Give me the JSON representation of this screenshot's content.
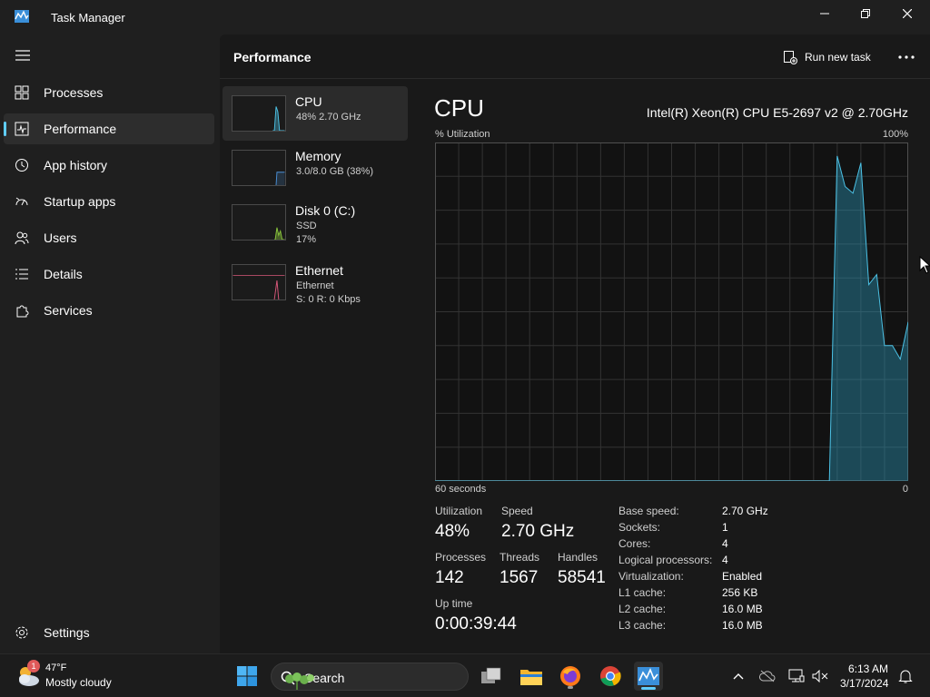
{
  "window": {
    "title": "Task Manager"
  },
  "sidebar": {
    "items": [
      {
        "label": "Processes",
        "icon": "grid-icon",
        "active": false
      },
      {
        "label": "Performance",
        "icon": "pulse-icon",
        "active": true
      },
      {
        "label": "App history",
        "icon": "history-icon",
        "active": false
      },
      {
        "label": "Startup apps",
        "icon": "gauge-icon",
        "active": false
      },
      {
        "label": "Users",
        "icon": "users-icon",
        "active": false
      },
      {
        "label": "Details",
        "icon": "list-icon",
        "active": false
      },
      {
        "label": "Services",
        "icon": "puzzle-icon",
        "active": false
      }
    ],
    "settings_label": "Settings"
  },
  "header": {
    "title": "Performance",
    "run_task_label": "Run new task"
  },
  "perf_list": [
    {
      "title": "CPU",
      "lines": [
        "48% 2.70 GHz"
      ],
      "color": "#4cc2e6",
      "active": true
    },
    {
      "title": "Memory",
      "lines": [
        "3.0/8.0 GB (38%)"
      ],
      "color": "#4a8fd6",
      "active": false
    },
    {
      "title": "Disk 0 (C:)",
      "lines": [
        "SSD",
        "17%"
      ],
      "color": "#8ac63c",
      "active": false
    },
    {
      "title": "Ethernet",
      "lines": [
        "Ethernet",
        "S: 0 R: 0 Kbps"
      ],
      "color": "#d8577a",
      "active": false
    }
  ],
  "detail": {
    "heading": "CPU",
    "model": "Intel(R) Xeon(R) CPU E5-2697 v2 @ 2.70GHz",
    "util_label": "% Utilization",
    "util_max": "100%",
    "time_left": "60 seconds",
    "time_right": "0",
    "graph_color": "#4cc2e6",
    "utilization_series": [
      0,
      0,
      0,
      0,
      0,
      0,
      0,
      0,
      0,
      0,
      0,
      0,
      0,
      0,
      0,
      0,
      0,
      0,
      0,
      0,
      0,
      0,
      0,
      0,
      0,
      0,
      0,
      0,
      0,
      0,
      0,
      0,
      0,
      0,
      0,
      0,
      0,
      0,
      0,
      0,
      0,
      0,
      0,
      0,
      0,
      0,
      0,
      0,
      0,
      0,
      0,
      96,
      87,
      85,
      94,
      58,
      61,
      40,
      40,
      36,
      47
    ],
    "stats": [
      {
        "label": "Utilization",
        "value": "48%"
      },
      {
        "label": "Speed",
        "value": "2.70 GHz"
      },
      {
        "label": "Processes",
        "value": "142"
      },
      {
        "label": "Threads",
        "value": "1567"
      },
      {
        "label": "Handles",
        "value": "58541"
      },
      {
        "label": "Up time",
        "value": "0:00:39:44"
      }
    ],
    "specs": [
      {
        "key": "Base speed:",
        "value": "2.70 GHz"
      },
      {
        "key": "Sockets:",
        "value": "1"
      },
      {
        "key": "Cores:",
        "value": "4"
      },
      {
        "key": "Logical processors:",
        "value": "4"
      },
      {
        "key": "Virtualization:",
        "value": "Enabled"
      },
      {
        "key": "L1 cache:",
        "value": "256 KB"
      },
      {
        "key": "L2 cache:",
        "value": "16.0 MB"
      },
      {
        "key": "L3 cache:",
        "value": "16.0 MB"
      }
    ]
  },
  "taskbar": {
    "weather_temp": "47°F",
    "weather_desc": "Mostly cloudy",
    "weather_badge": "1",
    "search_placeholder": "Search",
    "clock_time": "6:13 AM",
    "clock_date": "3/17/2024"
  }
}
